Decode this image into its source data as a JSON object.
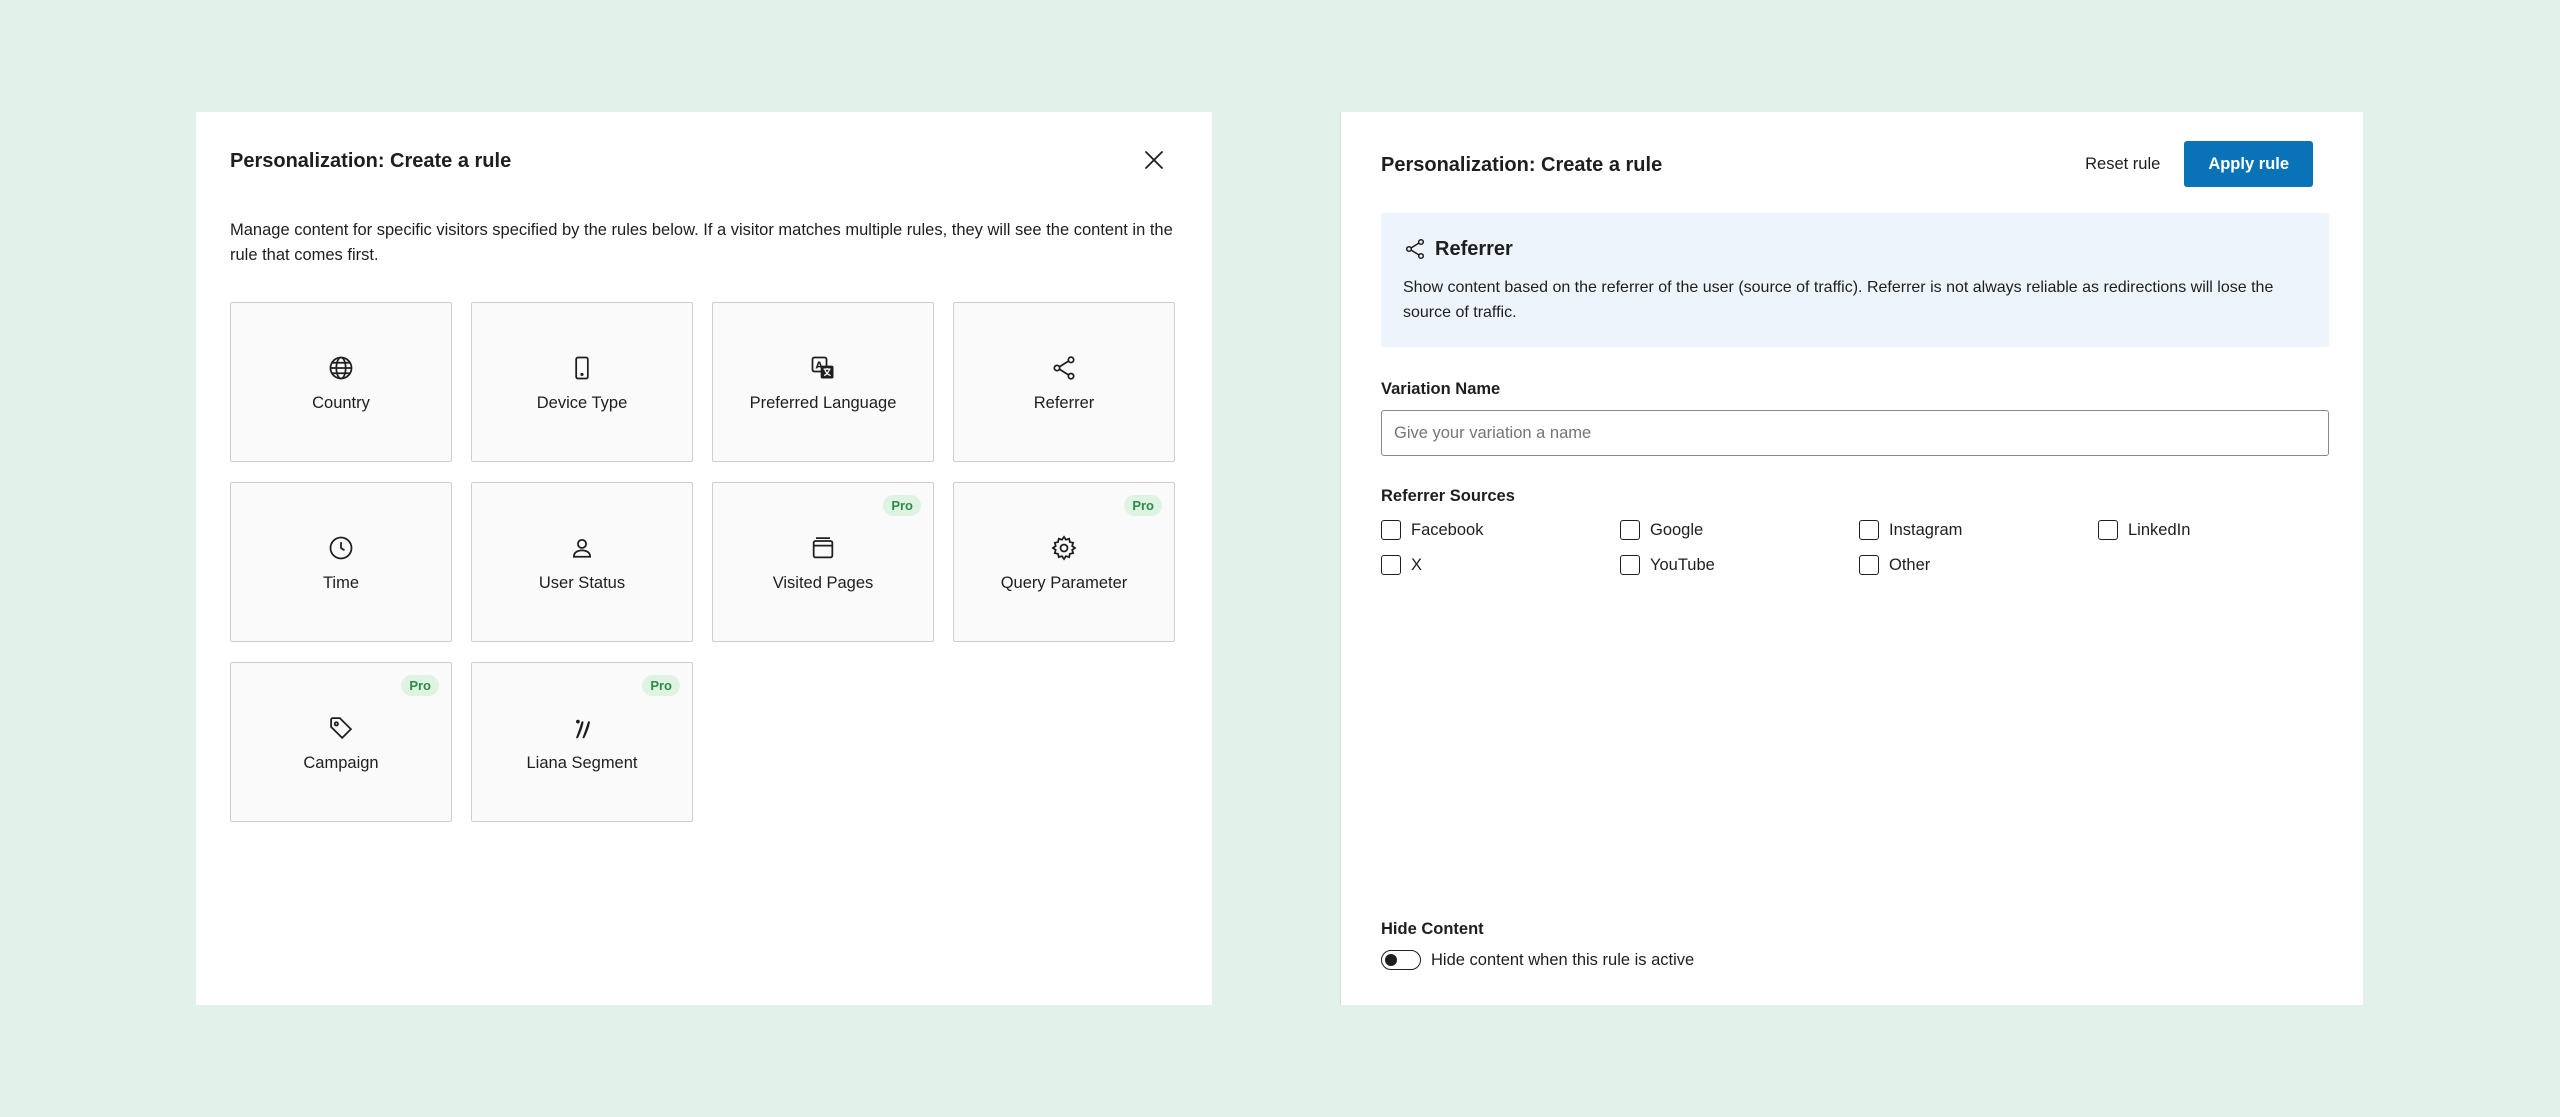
{
  "left_modal": {
    "title": "Personalization: Create a rule",
    "intro": "Manage content for specific visitors specified by the rules below. If a visitor matches multiple rules, they will see the content in the rule that comes first.",
    "tiles": [
      {
        "label": "Country",
        "icon": "globe-icon",
        "pro": false
      },
      {
        "label": "Device Type",
        "icon": "mobile-icon",
        "pro": false
      },
      {
        "label": "Preferred Language",
        "icon": "translate-icon",
        "pro": false
      },
      {
        "label": "Referrer",
        "icon": "share-icon",
        "pro": false
      },
      {
        "label": "Time",
        "icon": "clock-icon",
        "pro": false
      },
      {
        "label": "User Status",
        "icon": "user-icon",
        "pro": false
      },
      {
        "label": "Visited Pages",
        "icon": "pages-icon",
        "pro": true
      },
      {
        "label": "Query Parameter",
        "icon": "gear-icon",
        "pro": true
      },
      {
        "label": "Campaign",
        "icon": "tag-icon",
        "pro": true
      },
      {
        "label": "Liana Segment",
        "icon": "liana-logo-icon",
        "pro": true
      }
    ],
    "pro_label": "Pro"
  },
  "right_modal": {
    "title": "Personalization: Create a rule",
    "reset_label": "Reset rule",
    "apply_label": "Apply rule",
    "info": {
      "icon": "share-icon",
      "title": "Referrer",
      "text": "Show content based on the referrer of the user (source of traffic). Referrer is not always reliable as redirections will lose the source of traffic."
    },
    "variation_label": "Variation Name",
    "variation_placeholder": "Give your variation a name",
    "variation_value": "",
    "sources_label": "Referrer Sources",
    "sources": [
      {
        "label": "Facebook",
        "checked": false
      },
      {
        "label": "Google",
        "checked": false
      },
      {
        "label": "Instagram",
        "checked": false
      },
      {
        "label": "LinkedIn",
        "checked": false
      },
      {
        "label": "X",
        "checked": false
      },
      {
        "label": "YouTube",
        "checked": false
      },
      {
        "label": "Other",
        "checked": false
      }
    ],
    "hide_label": "Hide Content",
    "hide_toggle_label": "Hide content when this rule is active",
    "hide_toggle_on": false
  },
  "colors": {
    "background": "#e2f2ea",
    "accent": "#0a73b7",
    "pro_badge_bg": "#dff3e3",
    "pro_badge_text": "#2e8a47",
    "info_bg": "#eef4fb"
  }
}
